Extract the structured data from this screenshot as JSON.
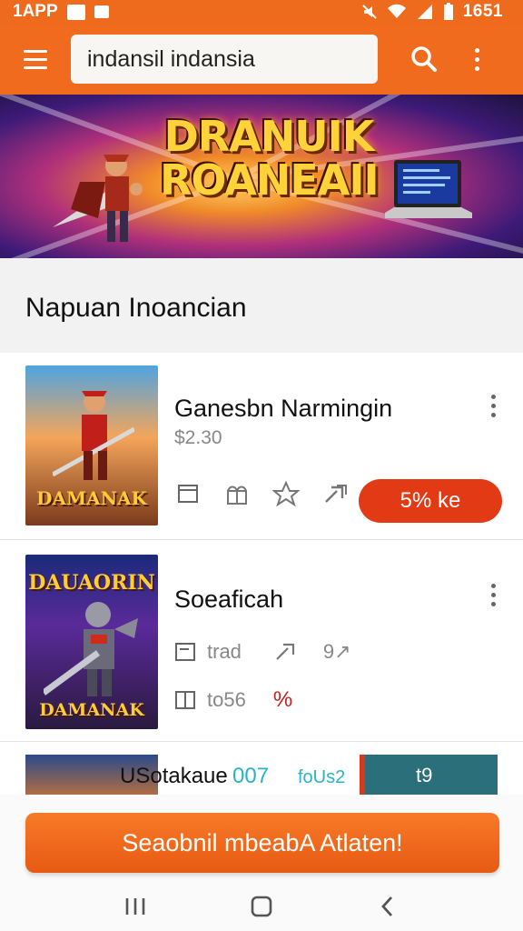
{
  "status_bar": {
    "carrier": "1APP",
    "time": "1651",
    "icons": [
      "image-icon",
      "mail-icon",
      "mute-icon",
      "wifi-icon",
      "signal-icon",
      "battery-icon"
    ]
  },
  "toolbar": {
    "search_value": "indansil indansia",
    "icons": [
      "menu-icon",
      "search-icon",
      "more-vert-icon"
    ]
  },
  "banner": {
    "title": "DRANUIK ROANEAII"
  },
  "section": {
    "title": "Napuan Inoancian"
  },
  "items": [
    {
      "title": "Ganesbn Narmingin",
      "price": "$2.30",
      "thumb_title": "DAMANAK",
      "buy_label": "5% ke",
      "actions": [
        "card-icon",
        "gift-icon",
        "star-icon",
        "share-icon"
      ]
    },
    {
      "title": "Soeaficah",
      "thumb_title_top": "DAUAORIN",
      "thumb_title_bottom": "DAMANAK",
      "meta": [
        {
          "icon": "card-icon",
          "text": "trad"
        },
        {
          "icon": "share-icon",
          "text": "9↗"
        },
        {
          "icon": "book-icon",
          "text": "to56"
        },
        {
          "icon": "",
          "text": "%"
        }
      ]
    },
    {
      "label": "USotakaue",
      "count": "007",
      "tag": "foUs2",
      "box_text": "t9"
    }
  ],
  "cta": {
    "label": "Seaobnil mbeabA Atlaten!"
  },
  "colors": {
    "accent": "#f06b1e",
    "buy_button": "#e23a14",
    "teal": "#29b3c8"
  }
}
